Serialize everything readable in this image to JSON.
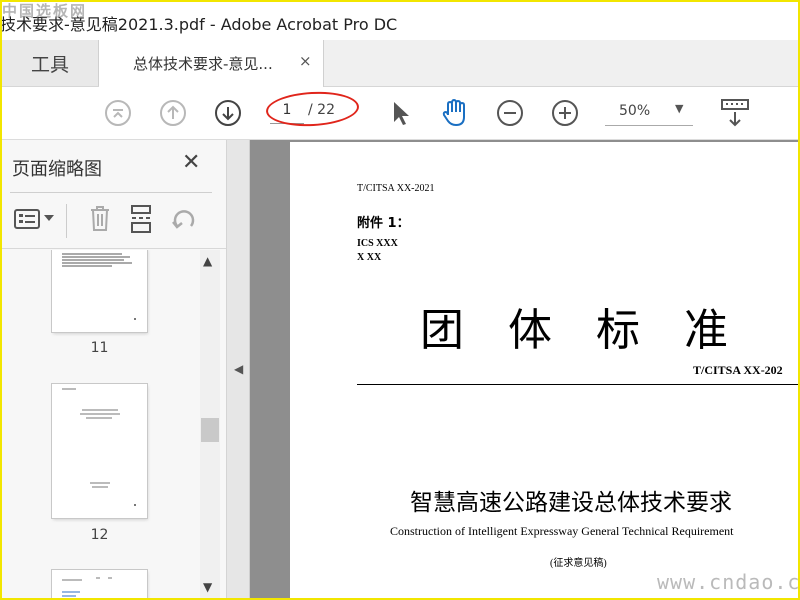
{
  "window": {
    "title": "技术要求-意见稿2021.3.pdf - Adobe Acrobat Pro DC"
  },
  "watermark": {
    "top": "中国选板网",
    "bottom": "www.cndao.com"
  },
  "tabs": {
    "tools_label": "工具",
    "document_label": "总体技术要求-意见...",
    "close_glyph": "×"
  },
  "toolbar": {
    "current_page": "1",
    "total_pages": "/ 22",
    "zoom": "50%",
    "icons": [
      "first-page-icon",
      "previous-page-icon",
      "next-page-icon",
      "select-arrow-icon",
      "hand-icon",
      "zoom-out-icon",
      "zoom-in-icon",
      "keyboard-scroll-icon"
    ],
    "annotation_color": "#e0251b"
  },
  "sidebar": {
    "title": "页面缩略图",
    "close_glyph": "✕",
    "thumbnails": [
      {
        "label": "11"
      },
      {
        "label": "12"
      },
      {
        "label": ""
      }
    ]
  },
  "document": {
    "code": "T/CITSA XX-2021",
    "attachment": "附件 1：",
    "ics": "ICS XXX",
    "xx": "X XX",
    "big_title": "团体标准",
    "standard_number": "T/CITSA  XX-202",
    "title_cn": "智慧高速公路建设总体技术要求",
    "title_en": "Construction of Intelligent Expressway General Technical Requirement",
    "draft_note": "(征求意见稿)"
  }
}
